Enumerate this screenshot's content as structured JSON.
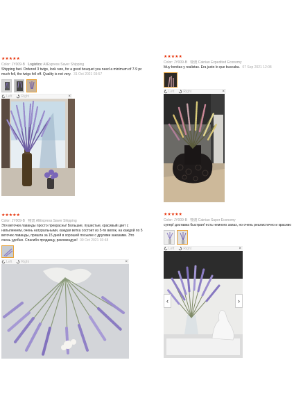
{
  "reviews": [
    {
      "stars": "★★★★★",
      "color_label": "Color:",
      "color_value": "JY009-B",
      "logistics_label": "Logistics:",
      "shipping": "AliExpress Saver Shipping",
      "text": "Shipping fast. Ordered 3 twigs, look rare, for a good bouquet you need a minimum of 7-9 pc much fell, the twigs fell off. Quality is not very.",
      "date": "31 Oct 2021 03:57",
      "rotate_left": "Left",
      "rotate_right": "Right",
      "close": "×"
    },
    {
      "stars": "★★★★★",
      "color_label": "Color:",
      "color_value": "JY009-B",
      "ship_from": "物流",
      "shipping": "Cainiao Expedited Economy",
      "text": "Muy bonitas y realistas. Era justo lo que buscaba.",
      "date": "07 Sep 2021 12:08",
      "rotate_left": "Left",
      "rotate_right": "Right",
      "close": "×"
    },
    {
      "stars": "★★★★★",
      "color_label": "Color:",
      "color_value": "JY009-B",
      "ship_from": "物流",
      "shipping": "AliExpress Saver Shipping",
      "text": "Эти веточки лаванды просто прекрасны! Большие, пушистые, красивый цвет с напылением, очень натуральными, каждая ветка состоит из 5-ти вилок, на каждой по 5 веточек лаванды, пришла за 15 дней в хорошей посылке с другими заказами. Это очень удобно. Спасибо продавцу, рекомендую!",
      "date": "09 Oct 2021 03:48",
      "rotate_left": "Left",
      "rotate_right": "Right",
      "close": "×"
    },
    {
      "stars": "★★★★★",
      "color_label": "Color:",
      "color_value": "JY009-B",
      "ship_from": "物流",
      "shipping": "Cainiao Super Economy",
      "text": "супер! доставка быстрая! есть немного запах, но очень реалистично и красиво",
      "date": "",
      "rotate_left": "Left",
      "rotate_right": "Right",
      "close": "×",
      "prev": "‹",
      "next": "›"
    }
  ],
  "colors": {
    "star": "#e62e04",
    "lavender": "#8d7fc4",
    "thumb_active_border": "#e8a33a"
  }
}
